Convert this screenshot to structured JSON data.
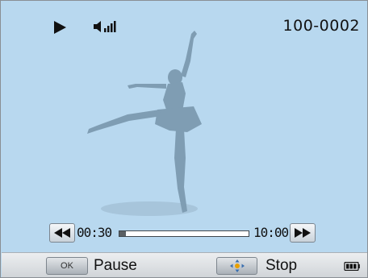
{
  "status": {
    "play_icon": "play-icon",
    "volume_icon": "volume-icon",
    "file_number": "100-0002"
  },
  "image": {
    "subject_icon": "ballet-dancer-silhouette"
  },
  "playback": {
    "elapsed": "00:30",
    "total": "10:00",
    "progress_fraction": 0.05,
    "rewind_icon": "rewind-icon",
    "forward_icon": "fast-forward-icon"
  },
  "controls": {
    "ok_key": "OK",
    "pause_label": "Pause",
    "dpad_icon": "dpad-icon",
    "stop_label": "Stop",
    "battery_icon": "battery-icon"
  },
  "colors": {
    "background": "#b8d8ef",
    "silhouette": "#7f9db3",
    "control_bar": "#dde1e4"
  }
}
